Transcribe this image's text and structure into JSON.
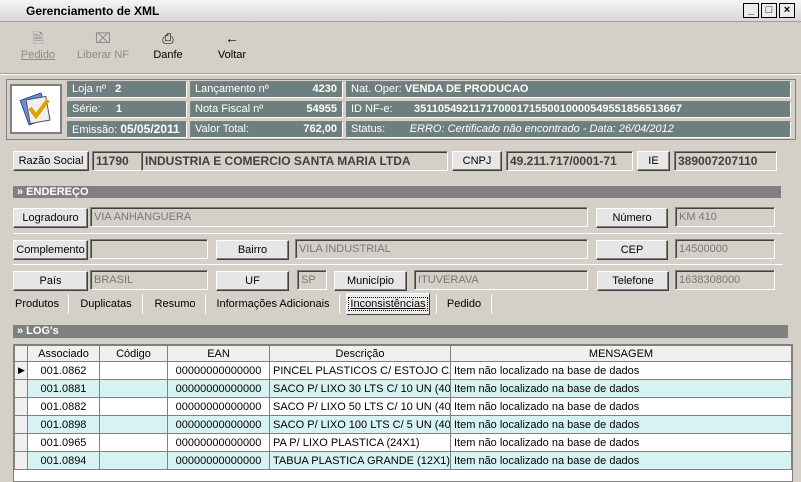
{
  "window": {
    "title": "Gerenciamento de XML",
    "min": "_",
    "max": "□",
    "close": "×"
  },
  "toolbar": {
    "pedido": "Pedido",
    "liberar": "Liberar NF",
    "danfe": "Danfe",
    "voltar": "Voltar"
  },
  "header": {
    "loja_label": "Loja nº",
    "loja": "2",
    "serie_label": "Série:",
    "serie": "1",
    "emissao_label": "Emissão:",
    "emissao": "05/05/2011",
    "lanc_label": "Lançamento nº",
    "lanc": "4230",
    "nf_label": "Nota Fiscal nº",
    "nf": "54955",
    "total_label": "Valor Total:",
    "total": "762,00",
    "natop_label": "Nat. Oper:",
    "natop": "VENDA DE PRODUCAO",
    "idnfe_label": "ID NF-e:",
    "idnfe": "35110549211717000171550010000549551856513667",
    "status_label": "Status:",
    "status": "ERRO: Certificado não encontrado - Data: 26/04/2012"
  },
  "empresa": {
    "razao_btn": "Razão Social",
    "codigo": "11790",
    "razao": "INDUSTRIA E COMERCIO SANTA MARIA LTDA",
    "cnpj_btn": "CNPJ",
    "cnpj": "49.211.717/0001-71",
    "ie_btn": "IE",
    "ie": "389007207110"
  },
  "endereco": {
    "section": "» ENDEREÇO",
    "logradouro_btn": "Logradouro",
    "logradouro": "VIA ANHANGUERA",
    "numero_btn": "Número",
    "numero": "KM 410",
    "complemento_btn": "Complemento",
    "complemento": "",
    "bairro_btn": "Bairro",
    "bairro": "VILA INDUSTRIAL",
    "cep_btn": "CEP",
    "cep": "14500000",
    "pais_btn": "País",
    "pais": "BRASIL",
    "uf_btn": "UF",
    "uf": "SP",
    "municipio_btn": "Município",
    "municipio": "ITUVERAVA",
    "telefone_btn": "Telefone",
    "telefone": "1638308000"
  },
  "tabs": [
    "Produtos",
    "Duplicatas",
    "Resumo",
    "Informações Adicionais",
    "Inconsistências",
    "Pedido"
  ],
  "log": {
    "section": "» LOG's",
    "columns": [
      "Associado",
      "Código",
      "EAN",
      "Descrição",
      "MENSAGEM"
    ],
    "rows": [
      [
        "001.0862",
        "",
        "00000000000000",
        "PINCEL PLASTICOS C/ ESTOJO CX",
        "Item não localizado na base de dados"
      ],
      [
        "001.0881",
        "",
        "00000000000000",
        "SACO P/ LIXO 30 LTS C/ 10 UN (40",
        "Item não localizado na base de dados"
      ],
      [
        "001.0882",
        "",
        "00000000000000",
        "SACO P/ LIXO 50 LTS C/ 10 UN (40",
        "Item não localizado na base de dados"
      ],
      [
        "001.0898",
        "",
        "00000000000000",
        "SACO P/ LIXO 100 LTS C/ 5 UN (40",
        "Item não localizado na base de dados"
      ],
      [
        "001.0965",
        "",
        "00000000000000",
        "PA P/ LIXO PLASTICA (24X1)",
        "Item não localizado na base de dados"
      ],
      [
        "001.0894",
        "",
        "00000000000000",
        "TABUA PLASTICA GRANDE (12X1)",
        "Item não localizado na base de dados"
      ]
    ]
  }
}
